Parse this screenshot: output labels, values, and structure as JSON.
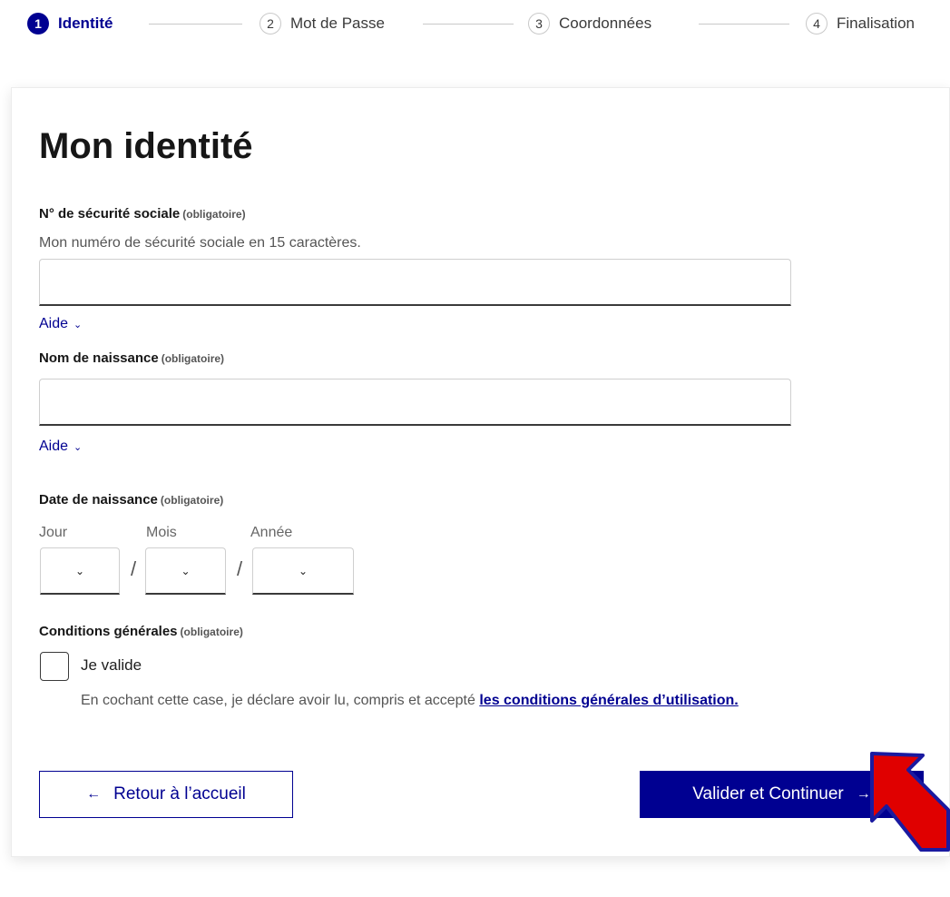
{
  "stepper": {
    "steps": [
      {
        "number": "1",
        "label": "Identité"
      },
      {
        "number": "2",
        "label": "Mot de Passe"
      },
      {
        "number": "3",
        "label": "Coordonnées"
      },
      {
        "number": "4",
        "label": "Finalisation"
      }
    ],
    "active_step": 1
  },
  "form": {
    "title": "Mon identité",
    "required_tag": "(obligatoire)",
    "ssn": {
      "label": "N° de sécurité sociale",
      "hint": "Mon numéro de sécurité sociale en 15 caractères.",
      "value": "",
      "help": "Aide"
    },
    "birth_name": {
      "label": "Nom de naissance",
      "value": "",
      "help": "Aide"
    },
    "birth_date": {
      "label": "Date de naissance",
      "day_label": "Jour",
      "month_label": "Mois",
      "year_label": "Année",
      "day_value": "",
      "month_value": "",
      "year_value": "",
      "separator": "/"
    },
    "terms": {
      "label": "Conditions générales",
      "checkbox_label": "Je valide",
      "checked": false,
      "text": "En cochant cette case, je déclare avoir lu, compris et accepté",
      "link": "les conditions générales d’utilisation."
    },
    "buttons": {
      "back": "Retour à l’accueil",
      "submit": "Valider et Continuer"
    }
  },
  "icons": {
    "chevron": "chevron-down-icon",
    "back_arrow": "arrow-left-icon",
    "next_arrow": "arrow-right-icon"
  },
  "colors": {
    "primary": "#000091",
    "annotation_arrow": "#e00000"
  }
}
